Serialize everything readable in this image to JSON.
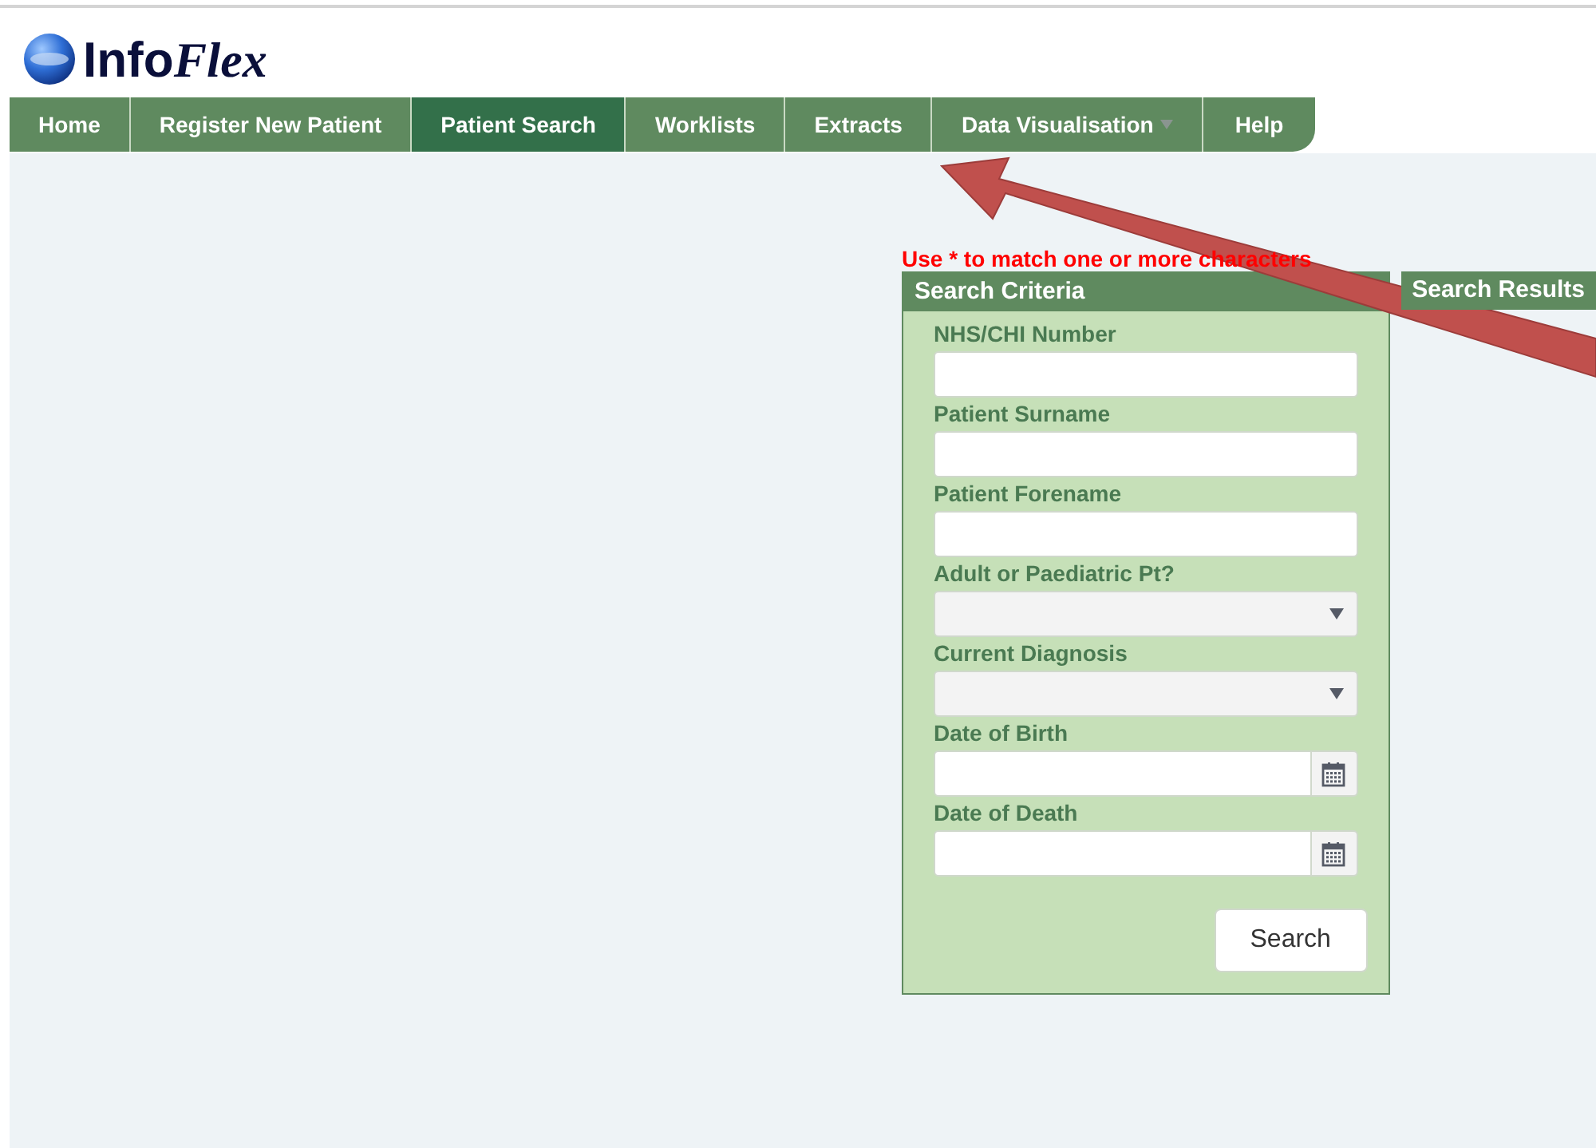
{
  "logo": {
    "plain": "Info",
    "styled": "Flex"
  },
  "nav": [
    {
      "label": "Home",
      "selected": false,
      "has_menu": false
    },
    {
      "label": "Register New Patient",
      "selected": false,
      "has_menu": false
    },
    {
      "label": "Patient Search",
      "selected": true,
      "has_menu": false
    },
    {
      "label": "Worklists",
      "selected": false,
      "has_menu": false
    },
    {
      "label": "Extracts",
      "selected": false,
      "has_menu": false
    },
    {
      "label": "Data Visualisation",
      "selected": false,
      "has_menu": true
    },
    {
      "label": "Help",
      "selected": false,
      "has_menu": false
    }
  ],
  "hint": "Use * to match one or more characters",
  "search_criteria": {
    "title": "Search Criteria",
    "fields": [
      {
        "label": "NHS/CHI Number",
        "kind": "text"
      },
      {
        "label": "Patient Surname",
        "kind": "text"
      },
      {
        "label": "Patient Forename",
        "kind": "text"
      },
      {
        "label": "Adult or Paediatric Pt?",
        "kind": "select"
      },
      {
        "label": "Current Diagnosis",
        "kind": "select"
      },
      {
        "label": "Date of Birth",
        "kind": "date"
      },
      {
        "label": "Date of Death",
        "kind": "date"
      }
    ],
    "button": "Search"
  },
  "search_results": {
    "title": "Search Results"
  }
}
